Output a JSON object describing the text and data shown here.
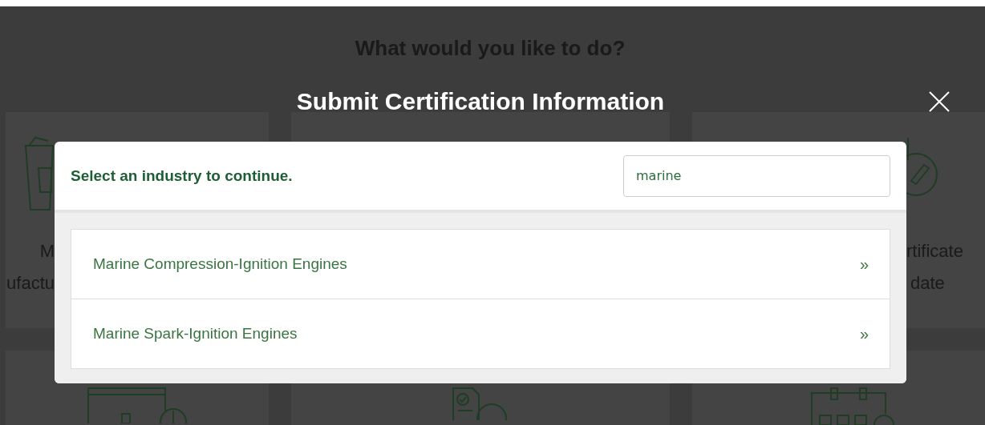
{
  "background": {
    "heading": "What would you like to do?",
    "cards": [
      {
        "kind": "folder",
        "label_lines": [
          "M",
          "ufactu"
        ]
      },
      {
        "kind": "blank"
      },
      {
        "kind": "pencil",
        "label_lines": [
          "rtificate",
          "date"
        ]
      },
      {
        "kind": "form"
      },
      {
        "kind": "document-check"
      },
      {
        "kind": "calendar"
      }
    ]
  },
  "modal": {
    "title": "Submit Certification Information",
    "prompt": "Select an industry to continue.",
    "search": {
      "value": "marine"
    },
    "results": [
      {
        "label": "Marine Compression-Ignition Engines",
        "chevron": "»"
      },
      {
        "label": "Marine Spark-Ignition Engines",
        "chevron": "»"
      }
    ]
  }
}
